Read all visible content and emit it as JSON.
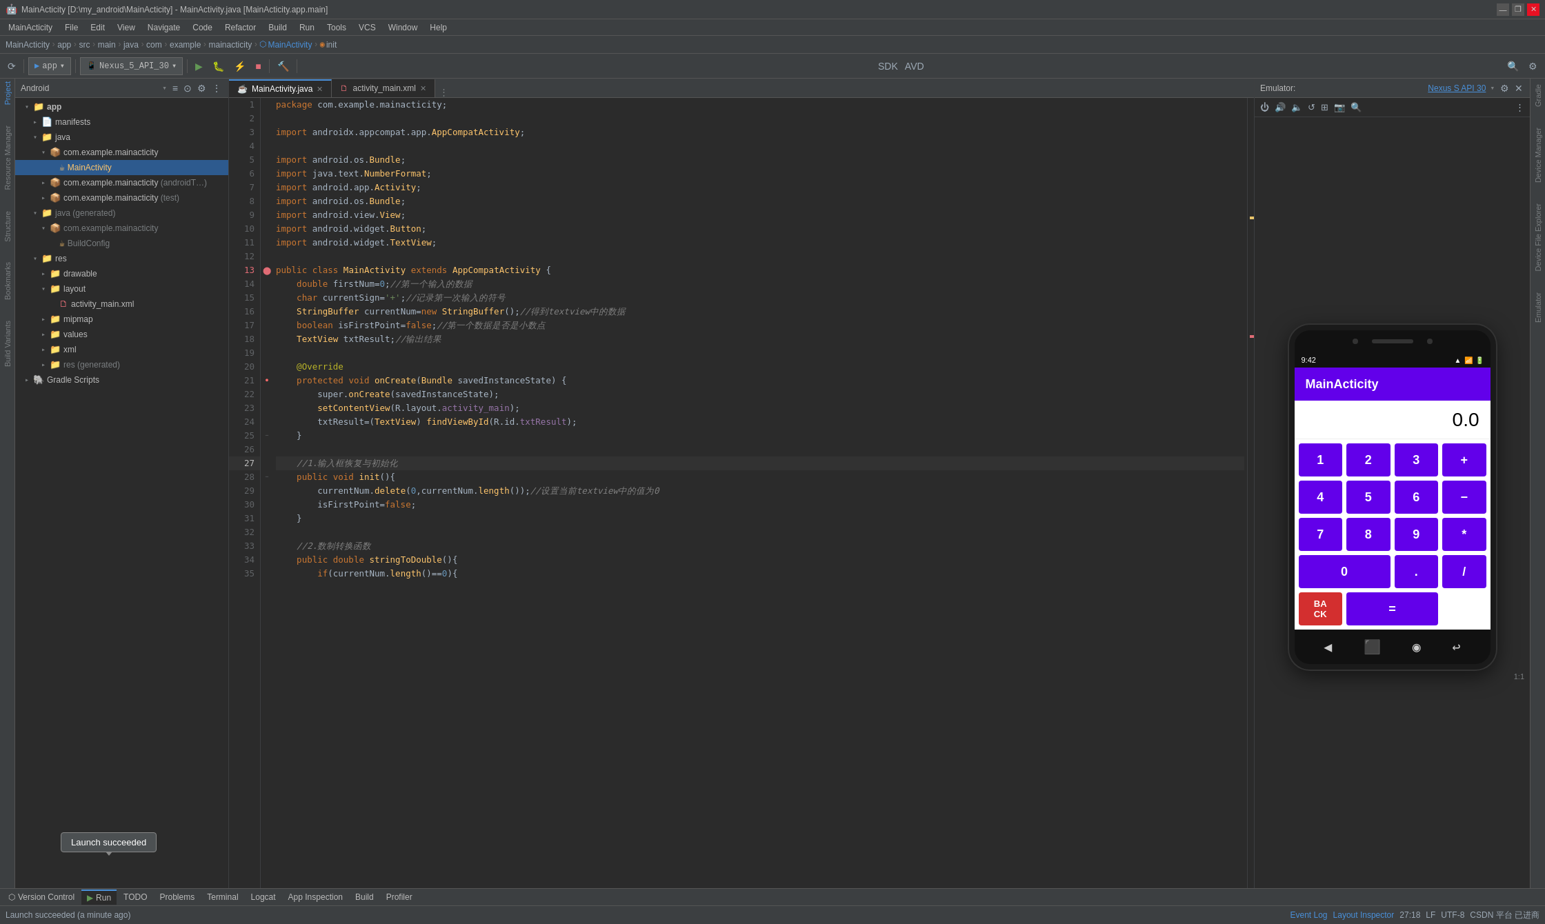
{
  "titlebar": {
    "title": "MainActicity [D:\\my_android\\MainActicity] - MainActivity.java [MainActicity.app.main]",
    "min": "—",
    "max": "❐",
    "close": "✕"
  },
  "menu": {
    "items": [
      "MainActicity",
      "File",
      "Edit",
      "View",
      "Navigate",
      "Code",
      "Refactor",
      "Build",
      "Run",
      "Tools",
      "VCS",
      "Window",
      "Help"
    ]
  },
  "breadcrumb": {
    "items": [
      "MainActicity",
      "app",
      "src",
      "main",
      "java",
      "com",
      "example",
      "mainacticity",
      "MainActivity",
      "init"
    ]
  },
  "toolbar": {
    "app_label": "app",
    "device_label": "Nexus_5_API_30"
  },
  "project_panel": {
    "title": "Android",
    "root": {
      "name": "app",
      "children": [
        {
          "name": "manifests",
          "indent": 1
        },
        {
          "name": "java",
          "indent": 1,
          "children": [
            {
              "name": "com.example.mainacticity",
              "indent": 2,
              "children": [
                {
                  "name": "MainActivity",
                  "indent": 3,
                  "type": "activity"
                }
              ]
            },
            {
              "name": "com.example.mainacticity (androidT...)",
              "indent": 2
            },
            {
              "name": "com.example.mainacticity (test)",
              "indent": 2
            }
          ]
        },
        {
          "name": "java (generated)",
          "indent": 1,
          "children": [
            {
              "name": "com.example.mainacticity",
              "indent": 2,
              "children": [
                {
                  "name": "BuildConfig",
                  "indent": 3
                }
              ]
            }
          ]
        },
        {
          "name": "res",
          "indent": 1,
          "children": [
            {
              "name": "drawable",
              "indent": 2
            },
            {
              "name": "layout",
              "indent": 2,
              "children": [
                {
                  "name": "activity_main.xml",
                  "indent": 3,
                  "type": "xml"
                }
              ]
            },
            {
              "name": "mipmap",
              "indent": 2
            },
            {
              "name": "values",
              "indent": 2
            },
            {
              "name": "xml",
              "indent": 2
            },
            {
              "name": "res (generated)",
              "indent": 2
            }
          ]
        }
      ]
    },
    "gradle": "Gradle Scripts"
  },
  "tabs": [
    {
      "label": "MainActivity.java",
      "active": true
    },
    {
      "label": "activity_main.xml",
      "active": false
    }
  ],
  "code": {
    "filename": "MainActivity.java",
    "lines": [
      {
        "num": 1,
        "content": "package com.example.mainacticity;"
      },
      {
        "num": 2,
        "content": ""
      },
      {
        "num": 3,
        "content": "import androidx.appcompat.app.AppCompatActivity;"
      },
      {
        "num": 4,
        "content": ""
      },
      {
        "num": 5,
        "content": "import android.os.Bundle;"
      },
      {
        "num": 6,
        "content": "import java.text.NumberFormat;"
      },
      {
        "num": 7,
        "content": "import android.app.Activity;"
      },
      {
        "num": 8,
        "content": "import android.os.Bundle;"
      },
      {
        "num": 9,
        "content": "import android.view.View;"
      },
      {
        "num": 10,
        "content": "import android.widget.Button;"
      },
      {
        "num": 11,
        "content": "import android.widget.TextView;"
      },
      {
        "num": 12,
        "content": ""
      },
      {
        "num": 13,
        "content": "public class MainActivity extends AppCompatActivity {"
      },
      {
        "num": 14,
        "content": "    double firstNum=0;//第一个输入的数据"
      },
      {
        "num": 15,
        "content": "    char currentSign='+';//记录第一次输入的符号"
      },
      {
        "num": 16,
        "content": "    StringBuffer currentNum=new StringBuffer();//得到textview中的数据"
      },
      {
        "num": 17,
        "content": "    boolean isFirstPoint=false;//第一个数据是否是小数点"
      },
      {
        "num": 18,
        "content": "    TextView txtResult;//输出结果"
      },
      {
        "num": 19,
        "content": ""
      },
      {
        "num": 20,
        "content": "    @Override"
      },
      {
        "num": 21,
        "content": "    protected void onCreate(Bundle savedInstanceState) {"
      },
      {
        "num": 22,
        "content": "        super.onCreate(savedInstanceState);"
      },
      {
        "num": 23,
        "content": "        setContentView(R.layout.activity_main);"
      },
      {
        "num": 24,
        "content": "        txtResult=(TextView) findViewById(R.id.txtResult);"
      },
      {
        "num": 25,
        "content": "    }"
      },
      {
        "num": 26,
        "content": ""
      },
      {
        "num": 27,
        "content": "    //1.输入框恢复与初始化"
      },
      {
        "num": 28,
        "content": "    public void init(){"
      },
      {
        "num": 29,
        "content": "        currentNum.delete(0,currentNum.length());//设置当前textview中的值为0"
      },
      {
        "num": 30,
        "content": "        isFirstPoint=false;"
      },
      {
        "num": 31,
        "content": "    }"
      },
      {
        "num": 32,
        "content": ""
      },
      {
        "num": 33,
        "content": "    //2.数制转换函数"
      },
      {
        "num": 34,
        "content": "    public double stringToDouble(){"
      },
      {
        "num": 35,
        "content": "        if(currentNum.length()==0){"
      }
    ]
  },
  "emulator": {
    "title": "Emulator:",
    "device": "Nexus S API 30",
    "phone": {
      "time": "9:42",
      "app_name": "MainActicity",
      "display": "0.0",
      "buttons": [
        [
          "1",
          "2",
          "3",
          "+"
        ],
        [
          "4",
          "5",
          "6",
          "−"
        ],
        [
          "7",
          "8",
          "9",
          "*"
        ],
        [
          "0",
          ".",
          "/"
        ],
        [
          "BACK",
          "="
        ]
      ]
    }
  },
  "bottom_tabs": {
    "items": [
      "Version Control",
      "Run",
      "TODO",
      "Problems",
      "Terminal",
      "Logcat",
      "App Inspection",
      "Build",
      "Profiler"
    ]
  },
  "status_bar": {
    "launch_message": "Launch succeeded (a minute ago)",
    "position": "27:18",
    "lf": "LF",
    "encoding": "UTF-8",
    "platform": "CSDN 平台 已进商",
    "event_log": "Event Log",
    "layout_inspector": "Layout Inspector"
  },
  "launch_tooltip": {
    "text": "Launch succeeded"
  },
  "run_tab": {
    "bottom_message": "Launch succeeded"
  },
  "sidebar_right_labels": [
    "Gradle",
    "Device Manager",
    "Device File Explorer",
    "Emulator"
  ],
  "sidebar_left_labels": [
    "Project",
    "Resource Manager",
    "Structure",
    "Bookmarks",
    "Build Variants"
  ]
}
